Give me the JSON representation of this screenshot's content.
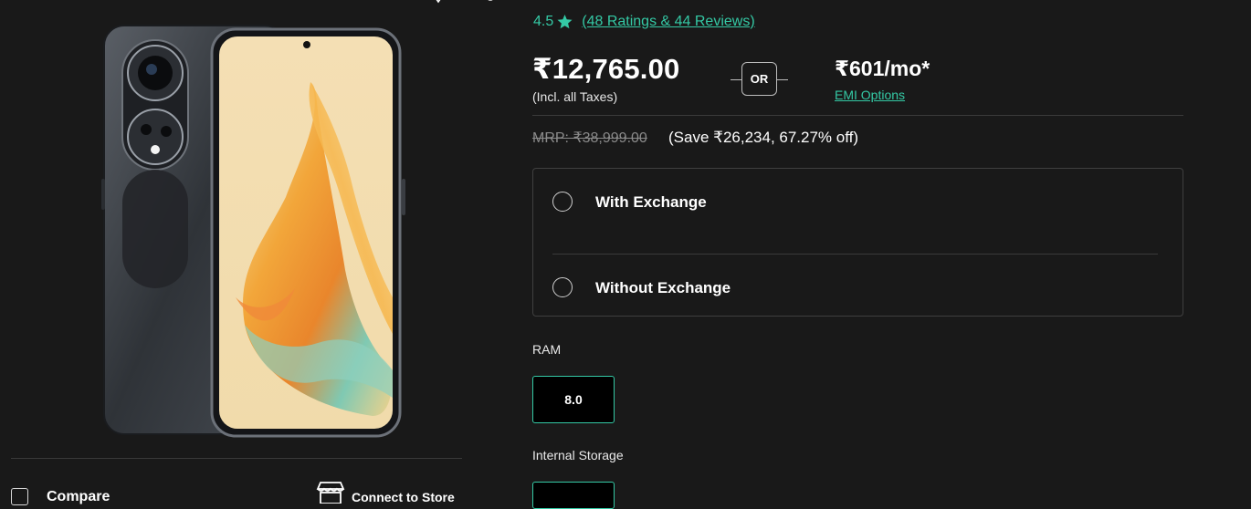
{
  "rating": {
    "value": "4.5",
    "reviews_link": "(48 Ratings & 44 Reviews)"
  },
  "pricing": {
    "price": "₹12,765.00",
    "price_note": "(Incl. all Taxes)",
    "or_label": "OR",
    "emi_amount": "₹601/mo*",
    "emi_link": "EMI Options",
    "mrp": "MRP: ₹38,999.00",
    "savings": "(Save ₹26,234, 67.27% off)"
  },
  "exchange_options": [
    {
      "label": "With Exchange",
      "selected": false
    },
    {
      "label": "Without Exchange",
      "selected": false
    }
  ],
  "ram": {
    "label": "RAM",
    "options": [
      "8.0"
    ]
  },
  "storage": {
    "label": "Internal Storage"
  },
  "actions": {
    "compare_label": "Compare",
    "store_label": "Connect to Store"
  },
  "colors": {
    "accent": "#34c9a5",
    "background": "#191919"
  }
}
